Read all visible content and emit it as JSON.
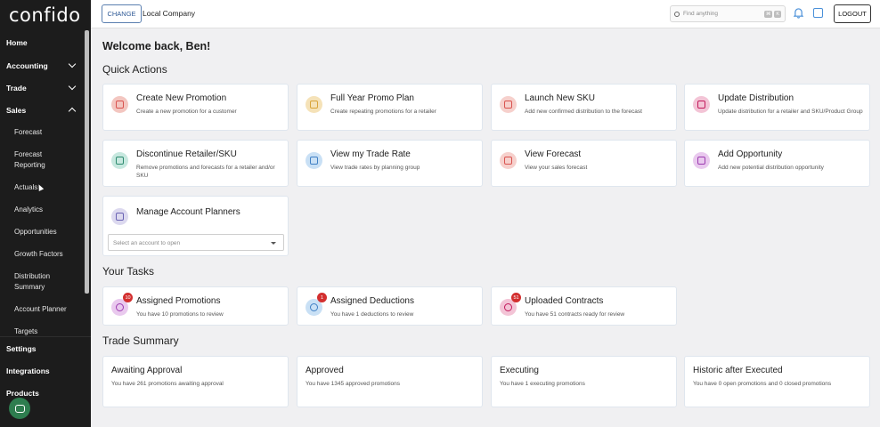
{
  "brand": {
    "logo_text": "confido"
  },
  "sidebar": {
    "top_items": [
      {
        "label": "Home",
        "has_chevron": false
      },
      {
        "label": "Accounting",
        "has_chevron": true
      },
      {
        "label": "Trade",
        "has_chevron": true
      },
      {
        "label": "Sales",
        "has_chevron": true,
        "expanded": true
      }
    ],
    "sales_items": [
      {
        "label": "Forecast"
      },
      {
        "label": "Forecast\nReporting"
      },
      {
        "label": "Actuals"
      },
      {
        "label": "Analytics"
      },
      {
        "label": "Opportunities"
      },
      {
        "label": "Growth Factors"
      },
      {
        "label": "Distribution\nSummary"
      },
      {
        "label": "Account Planner"
      },
      {
        "label": "Targets"
      }
    ],
    "bottom_items": [
      {
        "label": "Settings"
      },
      {
        "label": "Integrations"
      },
      {
        "label": "Products"
      }
    ],
    "chat_icon": "chat-icon"
  },
  "topbar": {
    "change_label": "CHANGE",
    "company_name": "Local Company",
    "search_placeholder": "Find anything",
    "search_kbd_1": "⌘",
    "search_kbd_2": "K",
    "logout_label": "LOGOUT"
  },
  "main": {
    "welcome": "Welcome back, Ben!",
    "quick_actions_title": "Quick Actions",
    "quick_actions": [
      {
        "title": "Create New Promotion",
        "desc": "Create a new promotion for a customer",
        "icon": "promotion-icon",
        "color": "#f3c6c0",
        "accent": "#d9534f"
      },
      {
        "title": "Full Year Promo Plan",
        "desc": "Create repeating promotions for a retailer",
        "icon": "calendar-icon",
        "color": "#f5e2b8",
        "accent": "#d9a43a"
      },
      {
        "title": "Launch New SKU",
        "desc": "Add new confirmed distribution to the forecast",
        "icon": "sku-icon",
        "color": "#f6d0cc",
        "accent": "#d9534f"
      },
      {
        "title": "Update Distribution",
        "desc": "Update distribution for a retailer and SKU/Product Group",
        "icon": "distribution-icon",
        "color": "#f3c4d6",
        "accent": "#c2185b"
      },
      {
        "title": "Discontinue Retailer/SKU",
        "desc": "Remove promotions and forecasts for a retailer and/or SKU",
        "icon": "discontinue-icon",
        "color": "#c7e8df",
        "accent": "#2e8b6f"
      },
      {
        "title": "View my Trade Rate",
        "desc": "View trade rates by planning group",
        "icon": "percent-icon",
        "color": "#c9e0f5",
        "accent": "#3f7fc4"
      },
      {
        "title": "View Forecast",
        "desc": "View your sales forecast",
        "icon": "forecast-icon",
        "color": "#f6d0cc",
        "accent": "#d9534f"
      },
      {
        "title": "Add Opportunity",
        "desc": "Add new potential distribution opportunity",
        "icon": "opportunity-icon",
        "color": "#e9c9ee",
        "accent": "#9c3bb0"
      },
      {
        "title": "Manage Account Planners",
        "desc": "",
        "icon": "planner-icon",
        "color": "#dcd9ef",
        "accent": "#6a62b3"
      }
    ],
    "account_select_placeholder": "Select an account to open",
    "tasks_title": "Your Tasks",
    "tasks": [
      {
        "title": "Assigned Promotions",
        "desc": "You have 10 promotions to review",
        "badge": "10",
        "icon": "promotion-task-icon",
        "color": "#e9c9ee",
        "accent": "#9c3bb0"
      },
      {
        "title": "Assigned Deductions",
        "desc": "You have 1 deductions to review",
        "badge": "1",
        "icon": "deduction-task-icon",
        "color": "#c9e0f5",
        "accent": "#3f7fc4"
      },
      {
        "title": "Uploaded Contracts",
        "desc": "You have 51 contracts ready for review",
        "badge": "51",
        "icon": "contract-task-icon",
        "color": "#f3c4d6",
        "accent": "#c2185b"
      }
    ],
    "summary_title": "Trade Summary",
    "summary": [
      {
        "title": "Awaiting Approval",
        "desc": "You have 261 promotions awaiting approval"
      },
      {
        "title": "Approved",
        "desc": "You have 1345 approved promotions"
      },
      {
        "title": "Executing",
        "desc": "You have 1 executing promotions"
      },
      {
        "title": "Historic after Executed",
        "desc": "You have 0 open promotions and 0 closed promotions"
      }
    ]
  }
}
